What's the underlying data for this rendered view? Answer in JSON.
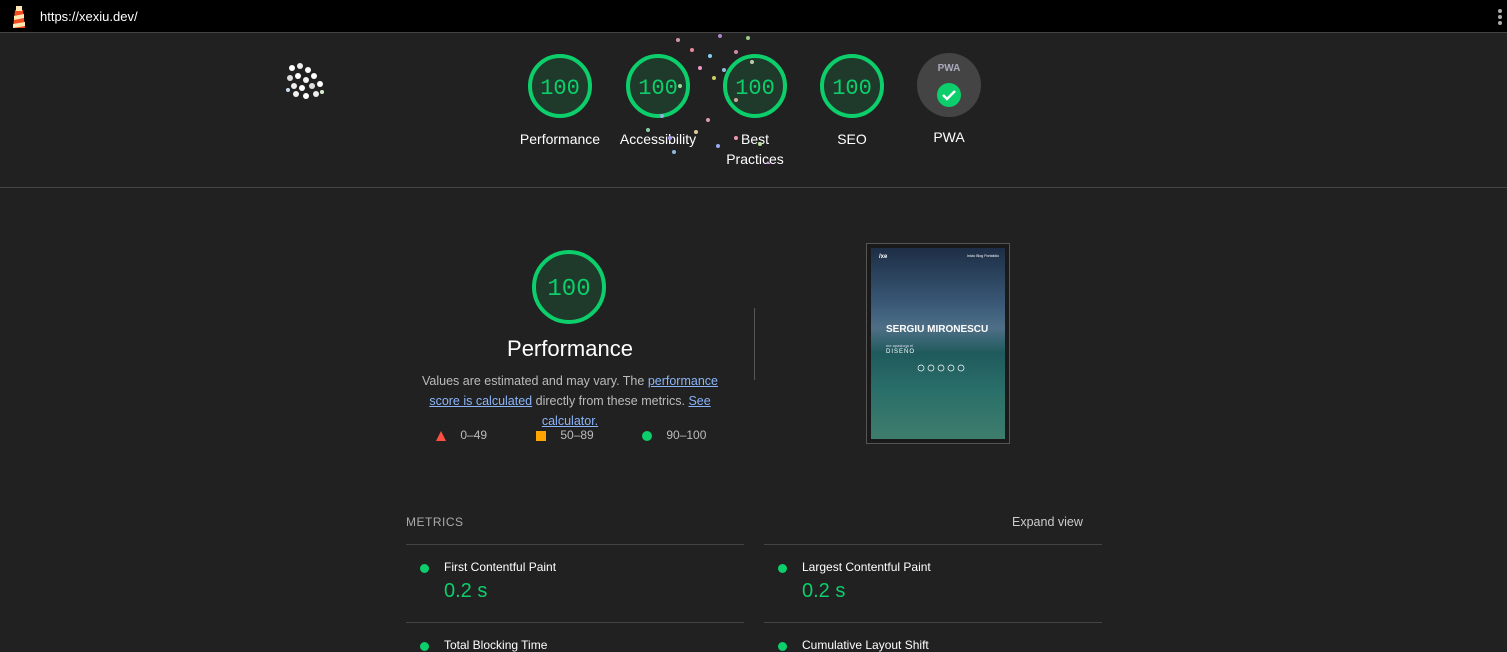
{
  "topbar": {
    "url": "https://xexiu.dev/"
  },
  "colors": {
    "pass": "#0cce6b",
    "average": "#ffa400",
    "fail": "#ff4e42",
    "background": "#212121"
  },
  "gauges": [
    {
      "score": "100",
      "label": "Performance"
    },
    {
      "score": "100",
      "label": "Accessibility"
    },
    {
      "score": "100",
      "label": "Best Practices"
    },
    {
      "score": "100",
      "label": "SEO"
    }
  ],
  "pwa": {
    "badge_text": "PWA",
    "label": "PWA"
  },
  "performance": {
    "score": "100",
    "title": "Performance",
    "desc_prefix": "Values are estimated and may vary. The ",
    "desc_link1": "performance score is calculated",
    "desc_middle": " directly from these metrics. ",
    "desc_link2": "See calculator."
  },
  "legend": [
    {
      "range": "0–49",
      "icon": "triangle-icon"
    },
    {
      "range": "50–89",
      "icon": "square-icon"
    },
    {
      "range": "90–100",
      "icon": "circle-icon"
    }
  ],
  "screenshot": {
    "logo": "/xe",
    "nav": "Inicio  Blog  Portafolio",
    "name": "SERGIU MIRONESCU",
    "sub": "me apasiona el",
    "word": "DISEÑO"
  },
  "metrics": {
    "header": "METRICS",
    "expand": "Expand view",
    "items": [
      {
        "name": "First Contentful Paint",
        "value": "0.2 s"
      },
      {
        "name": "Largest Contentful Paint",
        "value": "0.2 s"
      },
      {
        "name": "Total Blocking Time",
        "value": ""
      },
      {
        "name": "Cumulative Layout Shift",
        "value": ""
      }
    ]
  }
}
